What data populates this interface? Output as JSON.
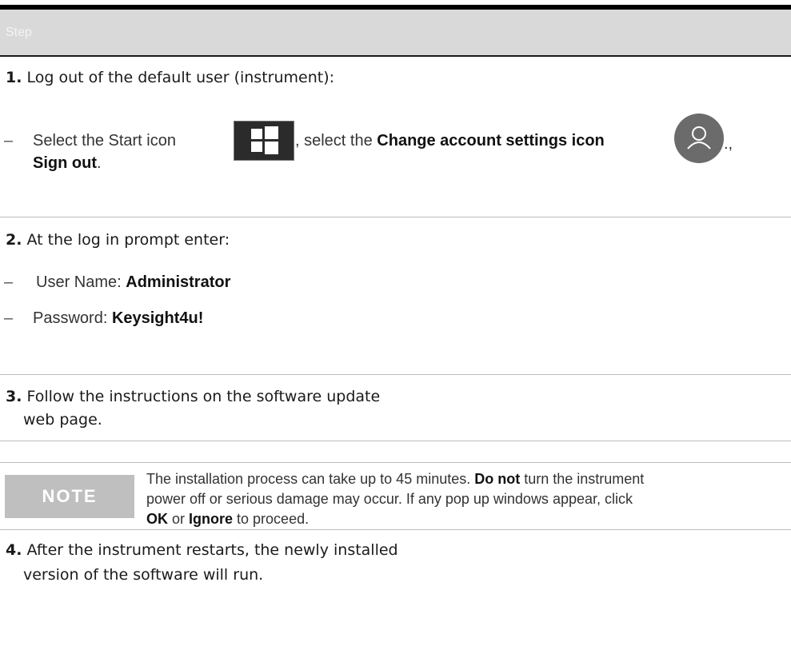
{
  "header": {
    "label": "Step"
  },
  "step1": {
    "num": "1.",
    "text": " Log out of the default user (instrument):",
    "bullet": "–",
    "t1": "Select the Start icon",
    "t2": ", select the ",
    "t3": "Change account settings icon",
    "t4": ".,",
    "t5": "Sign out",
    "t6": ".",
    "start_icon": "windows-start-icon",
    "account_icon": "user-account-icon"
  },
  "step2": {
    "num": "2.",
    "text": " At the log in prompt enter:",
    "bullet": "–",
    "username_label": "User Name: ",
    "username": "Administrator",
    "password_label": "Password: ",
    "password": "Keysight4u!"
  },
  "step3": {
    "num": "3.",
    "line1": " Follow the instructions on the software update",
    "line2": "web page."
  },
  "note": {
    "label": "NOTE",
    "t1": "The installation process can take up to 45 minutes. ",
    "t2": "Do not",
    "t3": " turn the instrument",
    "t4": "power off or serious damage may occur. If any pop up windows appear, click",
    "t5": "OK",
    "t6": " or ",
    "t7": "Ignore",
    "t8": " to proceed."
  },
  "step4": {
    "num": "4.",
    "line1": " After the instrument restarts, the newly installed",
    "line2": "version of the software will run."
  }
}
